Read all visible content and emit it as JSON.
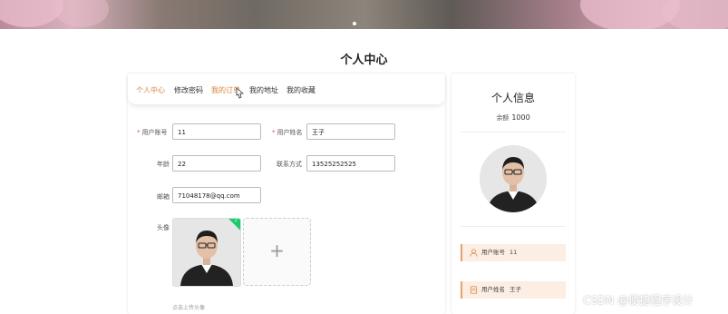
{
  "page": {
    "title": "个人中心"
  },
  "tabs": [
    {
      "label": "个人中心",
      "active": true
    },
    {
      "label": "修改密码",
      "active": false
    },
    {
      "label": "我的订单",
      "active": false
    },
    {
      "label": "我的地址",
      "active": false
    },
    {
      "label": "我的收藏",
      "active": false
    }
  ],
  "form": {
    "username": {
      "label": "用户账号",
      "required": true,
      "value": "11"
    },
    "fullname": {
      "label": "用户姓名",
      "required": true,
      "value": "王子"
    },
    "age": {
      "label": "年龄",
      "value": "22"
    },
    "phone": {
      "label": "联系方式",
      "value": "13525252525"
    },
    "email": {
      "label": "邮箱",
      "value": "71048178@qq.com"
    },
    "avatar": {
      "label": "头像",
      "upload_hint": "点击上传头像"
    }
  },
  "sidebar": {
    "title": "个人信息",
    "balance_label": "余额",
    "balance_value": "1000",
    "rows": [
      {
        "label": "用户账号",
        "value": "11",
        "icon": "user-icon"
      },
      {
        "label": "用户姓名",
        "value": "王子",
        "icon": "document-icon"
      }
    ]
  },
  "watermark": "CSDN @便捷程序设计",
  "colors": {
    "accent": "#e8843d",
    "success": "#13ce66",
    "info_row_bg": "#fdeee4"
  }
}
